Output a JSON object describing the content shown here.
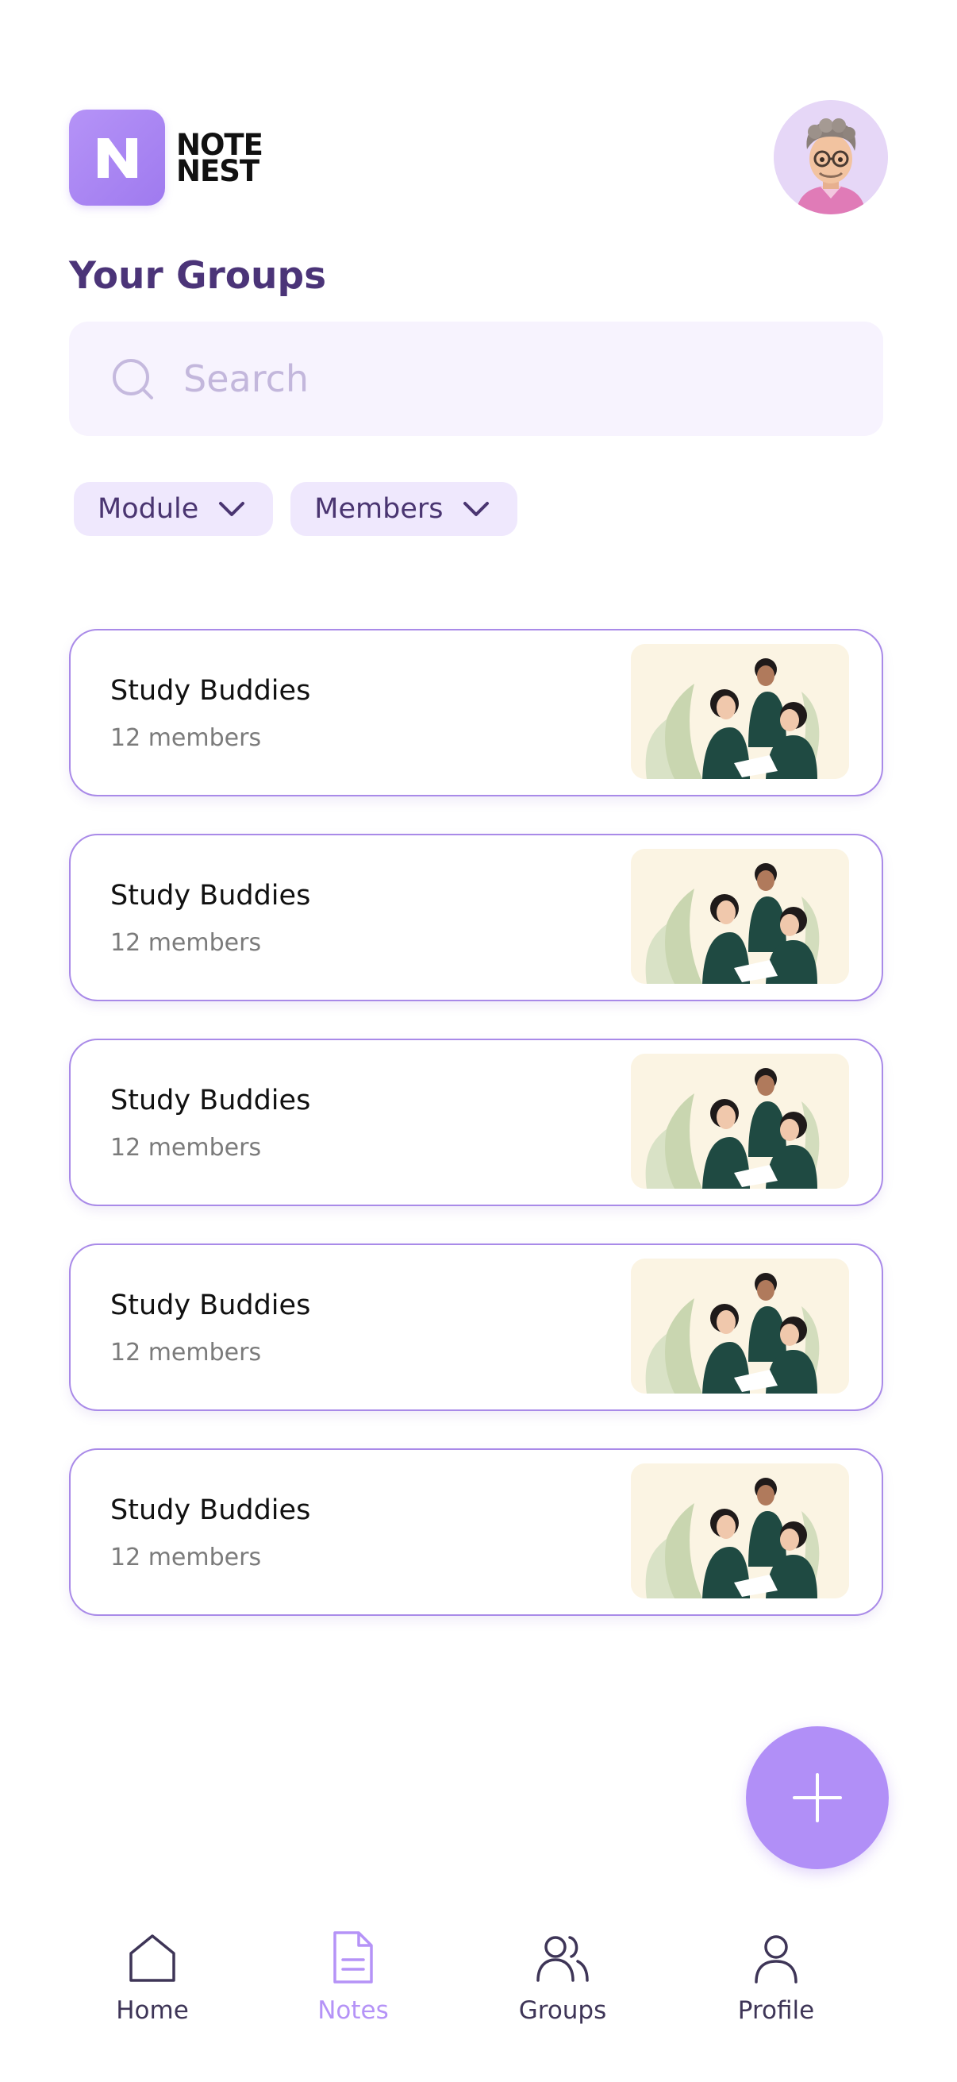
{
  "app": {
    "logo_line1": "NOTE",
    "logo_line2": "NEST",
    "logo_letter": "N"
  },
  "page": {
    "title": "Your Groups"
  },
  "search": {
    "placeholder": "Search",
    "value": ""
  },
  "filters": [
    {
      "label": "Module",
      "icon": "chevron-down-icon"
    },
    {
      "label": "Members",
      "icon": "chevron-down-icon"
    }
  ],
  "groups": [
    {
      "name": "Study Buddies",
      "members": "12 members"
    },
    {
      "name": "Study Buddies",
      "members": "12 members"
    },
    {
      "name": "Study Buddies",
      "members": "12 members"
    },
    {
      "name": "Study Buddies",
      "members": "12 members"
    },
    {
      "name": "Study Buddies",
      "members": "12 members"
    }
  ],
  "fab": {
    "icon": "plus-icon"
  },
  "nav": [
    {
      "label": "Home",
      "icon": "home-icon",
      "active": false
    },
    {
      "label": "Notes",
      "icon": "document-icon",
      "active": true
    },
    {
      "label": "Groups",
      "icon": "users-icon",
      "active": false
    },
    {
      "label": "Profile",
      "icon": "user-icon",
      "active": false
    }
  ],
  "colors": {
    "accent": "#b593f7",
    "title": "#4b3478",
    "card_border": "#a98ae8",
    "search_bg": "#f7f3fe",
    "chip_bg": "#efe8fd"
  }
}
